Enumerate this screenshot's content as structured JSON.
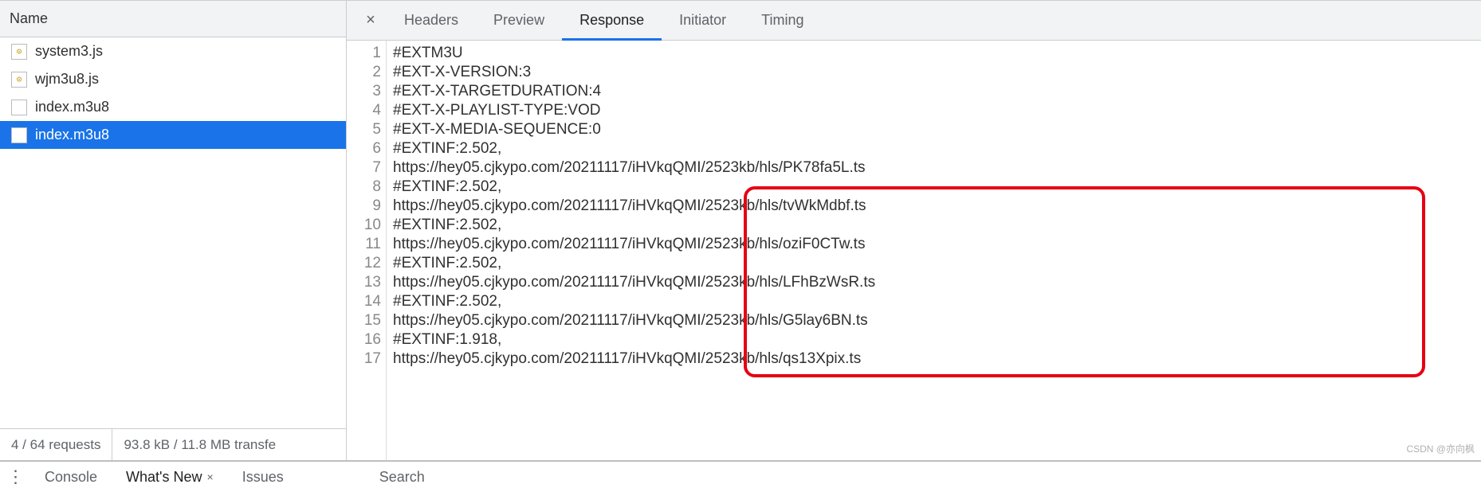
{
  "left": {
    "header": "Name",
    "items": [
      {
        "name": "system3.js",
        "kind": "js",
        "selected": false
      },
      {
        "name": "wjm3u8.js",
        "kind": "js",
        "selected": false
      },
      {
        "name": "index.m3u8",
        "kind": "doc",
        "selected": false
      },
      {
        "name": "index.m3u8",
        "kind": "doc",
        "selected": true
      }
    ],
    "status": {
      "count": "4 / 64 requests",
      "transfer": "93.8 kB / 11.8 MB transfe"
    }
  },
  "tabs": {
    "items": [
      "Headers",
      "Preview",
      "Response",
      "Initiator",
      "Timing"
    ],
    "active": 2
  },
  "code_lines": [
    "#EXTM3U",
    "#EXT-X-VERSION:3",
    "#EXT-X-TARGETDURATION:4",
    "#EXT-X-PLAYLIST-TYPE:VOD",
    "#EXT-X-MEDIA-SEQUENCE:0",
    "#EXTINF:2.502,",
    "https://hey05.cjkypo.com/20211117/iHVkqQMI/2523kb/hls/PK78fa5L.ts",
    "#EXTINF:2.502,",
    "https://hey05.cjkypo.com/20211117/iHVkqQMI/2523kb/hls/tvWkMdbf.ts",
    "#EXTINF:2.502,",
    "https://hey05.cjkypo.com/20211117/iHVkqQMI/2523kb/hls/oziF0CTw.ts",
    "#EXTINF:2.502,",
    "https://hey05.cjkypo.com/20211117/iHVkqQMI/2523kb/hls/LFhBzWsR.ts",
    "#EXTINF:2.502,",
    "https://hey05.cjkypo.com/20211117/iHVkqQMI/2523kb/hls/G5lay6BN.ts",
    "#EXTINF:1.918,",
    "https://hey05.cjkypo.com/20211117/iHVkqQMI/2523kb/hls/qs13Xpix.ts"
  ],
  "drawer": {
    "items": [
      {
        "label": "Console",
        "closeable": false
      },
      {
        "label": "What's New",
        "closeable": true
      },
      {
        "label": "Issues",
        "closeable": false
      },
      {
        "label": "Search",
        "closeable": false
      }
    ],
    "active": 1
  },
  "icons": {
    "js_glyph": "⊙",
    "close_x": "×",
    "drawer_close": "×"
  },
  "watermark": "CSDN @亦向枫"
}
